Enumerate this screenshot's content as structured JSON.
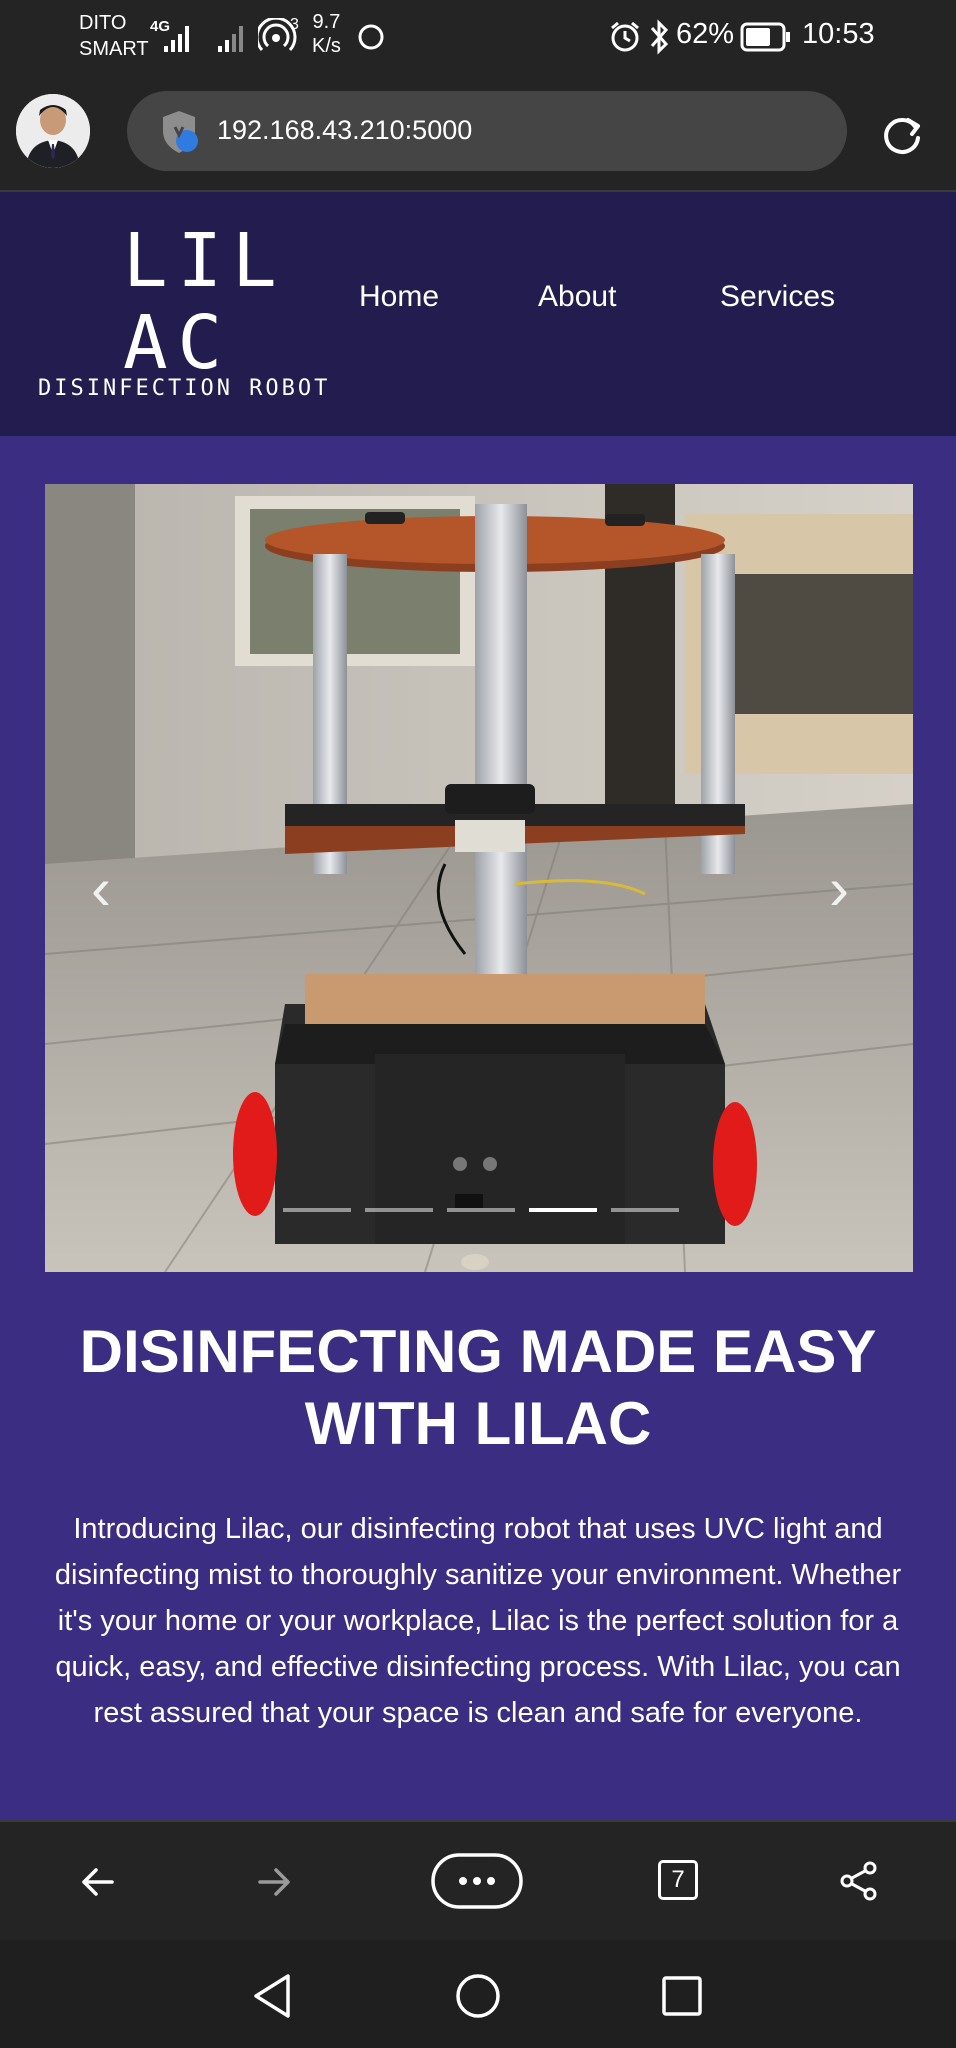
{
  "status_bar": {
    "carrier_line1": "DITO",
    "carrier_line2": "SMART",
    "network": "4G",
    "speed_value": "9.7",
    "speed_unit": "K/s",
    "battery": "62%",
    "time": "10:53"
  },
  "browser": {
    "url": "192.168.43.210:5000",
    "tab_count": "7"
  },
  "site": {
    "logo_line1": "LIL",
    "logo_line2": "AC",
    "logo_sub": "DISINFECTION ROBOT",
    "nav": [
      "Home",
      "About",
      "Services"
    ]
  },
  "carousel": {
    "slide_count": 5,
    "active_index": 3,
    "prev_glyph": "‹",
    "next_glyph": "›"
  },
  "hero": {
    "title_line1": "DISINFECTING MADE EASY",
    "title_line2": "WITH LILAC",
    "text": "Introducing Lilac, our disinfecting robot that uses UVC light and disinfecting mist to thoroughly sanitize your environment. Whether it's your home or your workplace, Lilac is the perfect solution for a quick, easy, and effective disinfecting process. With Lilac, you can rest assured that your space is clean and safe for everyone."
  },
  "colors": {
    "header_bg": "#231c4f",
    "hero_bg": "#3b2d82"
  }
}
